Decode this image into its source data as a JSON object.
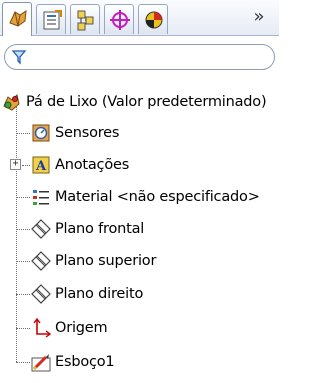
{
  "tabs": [
    {
      "icon": "feature-manager-icon",
      "active": true
    },
    {
      "icon": "property-manager-icon",
      "active": false
    },
    {
      "icon": "configuration-manager-icon",
      "active": false
    },
    {
      "icon": "dimxpert-manager-icon",
      "active": false
    },
    {
      "icon": "display-manager-icon",
      "active": false
    }
  ],
  "overflow_label": "»",
  "filter": {
    "placeholder": "",
    "value": ""
  },
  "tree": {
    "root": {
      "label": "Pá de Lixo  (Valor predeterminado)",
      "icon": "part-icon"
    },
    "items": [
      {
        "label": "Sensores",
        "icon": "sensors-icon"
      },
      {
        "label": "Anotações",
        "icon": "annotations-icon",
        "expandable": true,
        "expander": "+"
      },
      {
        "label": "Material <não especificado>",
        "icon": "material-icon"
      },
      {
        "label": "Plano frontal",
        "icon": "plane-icon"
      },
      {
        "label": "Plano superior",
        "icon": "plane-icon"
      },
      {
        "label": "Plano direito",
        "icon": "plane-icon"
      },
      {
        "label": "Origem",
        "icon": "origin-icon"
      },
      {
        "label": "Esboço1",
        "icon": "sketch-icon"
      }
    ]
  },
  "colors": {
    "tab_border": "#98a8c0",
    "tree_line": "#6d6d6d",
    "origin_red": "#cc0000"
  }
}
